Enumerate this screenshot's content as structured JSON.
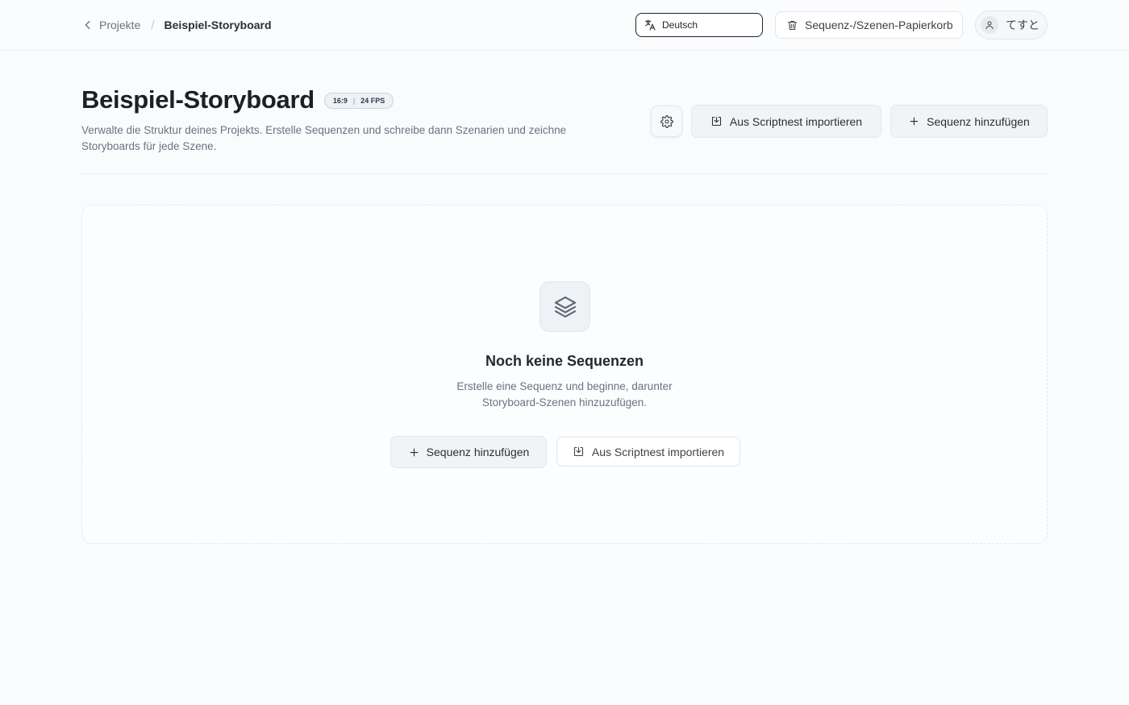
{
  "breadcrumb": {
    "back_label": "Projekte",
    "separator": "/",
    "current": "Beispiel-Storyboard"
  },
  "topbar": {
    "language": "Deutsch",
    "trash_label": "Sequenz-/Szenen-Papierkorb",
    "user_name": "てすと"
  },
  "header": {
    "title": "Beispiel-Storyboard",
    "aspect_ratio": "16:9",
    "badge_separator": "|",
    "fps": "24 FPS",
    "subtitle": "Verwalte die Struktur deines Projekts. Erstelle Sequenzen und schreibe dann Szenarien und zeichne Storyboards für jede Szene.",
    "import_label": "Aus Scriptnest importieren",
    "add_label": "Sequenz hinzufügen"
  },
  "empty_state": {
    "title": "Noch keine Sequenzen",
    "description": "Erstelle eine Sequenz und beginne, darunter Storyboard-Szenen hinzuzufügen.",
    "add_label": "Sequenz hinzufügen",
    "import_label": "Aus Scriptnest importieren"
  },
  "icons": {
    "back": "chevron-left-icon",
    "language": "translate-icon",
    "trash": "trash-icon",
    "user": "user-icon",
    "settings": "gear-icon",
    "import": "import-icon",
    "add": "plus-icon",
    "empty": "layers-icon"
  },
  "colors": {
    "background": "#f9fcfd",
    "text_primary": "#1c2024",
    "text_muted": "#6b7280",
    "button_bg": "#f1f4f7",
    "badge_bg": "#eef2f6"
  }
}
